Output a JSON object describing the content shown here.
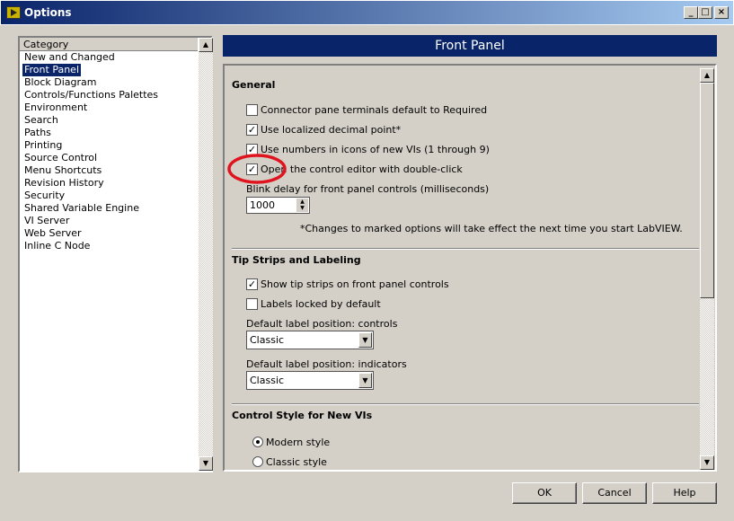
{
  "window": {
    "title": "Options",
    "controls": [
      "_",
      "□",
      "×"
    ]
  },
  "category": {
    "header": "Category",
    "items": [
      "New and Changed",
      "Front Panel",
      "Block Diagram",
      "Controls/Functions Palettes",
      "Environment",
      "Search",
      "Paths",
      "Printing",
      "Source Control",
      "Menu Shortcuts",
      "Revision History",
      "Security",
      "Shared Variable Engine",
      "VI Server",
      "Web Server",
      "Inline C Node"
    ],
    "selected": "Front Panel"
  },
  "page_title": "Front Panel",
  "general": {
    "heading": "General",
    "options": [
      {
        "label": "Connector pane terminals default to Required",
        "checked": false
      },
      {
        "label": "Use localized decimal point*",
        "checked": true
      },
      {
        "label": "Use numbers in icons of new VIs (1 through 9)",
        "checked": true
      },
      {
        "label": "Open the control editor with double-click",
        "checked": true
      }
    ],
    "blink_label": "Blink delay for front panel controls (milliseconds)",
    "blink_value": "1000",
    "note": "*Changes to marked options will take effect the next time you start LabVIEW."
  },
  "tips": {
    "heading": "Tip Strips and Labeling",
    "options": [
      {
        "label": "Show tip strips on front panel controls",
        "checked": true
      },
      {
        "label": "Labels locked by default",
        "checked": false
      }
    ],
    "controls_label": "Default label position: controls",
    "controls_value": "Classic",
    "indicators_label": "Default label position: indicators",
    "indicators_value": "Classic"
  },
  "style": {
    "heading": "Control Style for New VIs",
    "options": [
      {
        "label": "Modern style",
        "selected": true
      },
      {
        "label": "Classic style",
        "selected": false
      }
    ]
  },
  "buttons": {
    "ok": "OK",
    "cancel": "Cancel",
    "help": "Help"
  },
  "annotation_color": "#e0141e"
}
